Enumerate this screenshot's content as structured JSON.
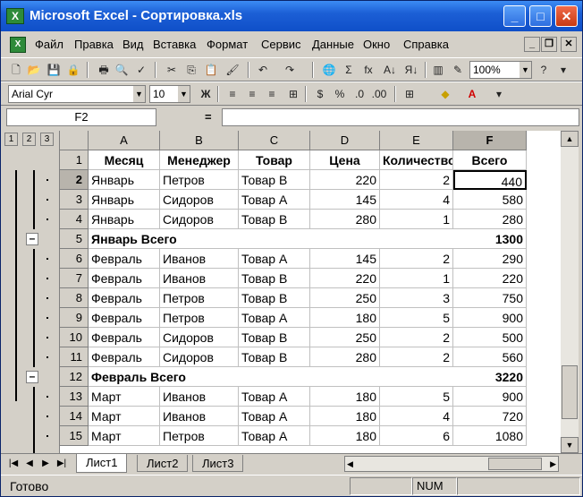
{
  "window": {
    "title": "Microsoft Excel - Сортировка.xls"
  },
  "menu": [
    "Файл",
    "Правка",
    "Вид",
    "Вставка",
    "Формат",
    "Сервис",
    "Данные",
    "Окно",
    "Справка"
  ],
  "toolbar": {
    "zoom": "100%",
    "font": "Arial Cyr",
    "size": "10",
    "bold": "Ж"
  },
  "formula": {
    "namebox": "F2",
    "eq": "=",
    "value": ""
  },
  "outline_levels": [
    "1",
    "2",
    "3"
  ],
  "columns": [
    "A",
    "B",
    "C",
    "D",
    "E",
    "F"
  ],
  "rows": [
    {
      "n": "1",
      "cells": [
        "Месяц",
        "Менеджер",
        "Товар",
        "Цена",
        "Количество",
        "Всего"
      ],
      "header": true
    },
    {
      "n": "2",
      "cells": [
        "Январь",
        "Петров",
        "Товар В",
        "220",
        "2",
        "440"
      ]
    },
    {
      "n": "3",
      "cells": [
        "Январь",
        "Сидоров",
        "Товар А",
        "145",
        "4",
        "580"
      ]
    },
    {
      "n": "4",
      "cells": [
        "Январь",
        "Сидоров",
        "Товар В",
        "280",
        "1",
        "280"
      ]
    },
    {
      "n": "5",
      "cells": [
        "Январь Всего",
        "",
        "",
        "",
        "",
        "1300"
      ],
      "total": true
    },
    {
      "n": "6",
      "cells": [
        "Февраль",
        "Иванов",
        "Товар А",
        "145",
        "2",
        "290"
      ]
    },
    {
      "n": "7",
      "cells": [
        "Февраль",
        "Иванов",
        "Товар В",
        "220",
        "1",
        "220"
      ]
    },
    {
      "n": "8",
      "cells": [
        "Февраль",
        "Петров",
        "Товар В",
        "250",
        "3",
        "750"
      ]
    },
    {
      "n": "9",
      "cells": [
        "Февраль",
        "Петров",
        "Товар А",
        "180",
        "5",
        "900"
      ]
    },
    {
      "n": "10",
      "cells": [
        "Февраль",
        "Сидоров",
        "Товар В",
        "250",
        "2",
        "500"
      ]
    },
    {
      "n": "11",
      "cells": [
        "Февраль",
        "Сидоров",
        "Товар В",
        "280",
        "2",
        "560"
      ]
    },
    {
      "n": "12",
      "cells": [
        "Февраль Всего",
        "",
        "",
        "",
        "",
        "3220"
      ],
      "total": true
    },
    {
      "n": "13",
      "cells": [
        "Март",
        "Иванов",
        "Товар А",
        "180",
        "5",
        "900"
      ]
    },
    {
      "n": "14",
      "cells": [
        "Март",
        "Иванов",
        "Товар А",
        "180",
        "4",
        "720"
      ]
    },
    {
      "n": "15",
      "cells": [
        "Март",
        "Петров",
        "Товар А",
        "180",
        "6",
        "1080"
      ]
    }
  ],
  "sheets": [
    "Лист1",
    "Лист2",
    "Лист3"
  ],
  "status": {
    "left": "Готово",
    "num": "NUM"
  }
}
